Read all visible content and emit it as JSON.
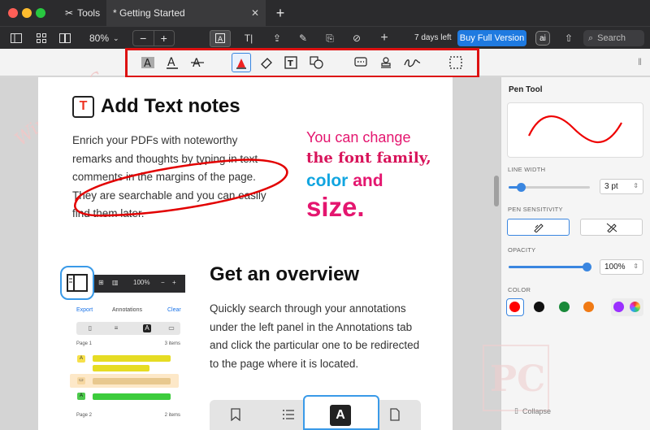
{
  "window": {
    "tabs": [
      {
        "label": "Tools"
      },
      {
        "label": "* Getting Started"
      }
    ]
  },
  "toolbar": {
    "zoom": "80%",
    "trial": "7 days left",
    "buy": "Buy Full Version",
    "ai": "ai",
    "search_placeholder": "Search"
  },
  "document": {
    "watermark": "Winning PC",
    "section1": {
      "title": "Add Text notes",
      "icon_letter": "T",
      "body": "Enrich your PDFs with noteworthy remarks and thoughts by typing in text comments in the margins of the page. They are searchable and you can easily find them later.",
      "note_line1": "You can change",
      "note_line2": "the font family,",
      "note_color": "color",
      "note_and": "and",
      "note_size": "size."
    },
    "section2": {
      "title": "Get an overview",
      "body": "Quickly search through your annotations under the left panel in the Annotations tab and click the particular one to be redirected to the page where it is located."
    },
    "mini": {
      "zoom": "100%",
      "export": "Export",
      "annotations": "Annotations",
      "clear": "Clear",
      "page1": "Page 1",
      "page1_count": "3 items",
      "page2": "Page 2",
      "page2_count": "2 items",
      "tag_a": "A"
    },
    "bottom_tab_a": "A"
  },
  "panel": {
    "title": "Pen Tool",
    "line_width_label": "LINE WIDTH",
    "line_width_value": "3 pt",
    "sensitivity_label": "PEN SENSITIVITY",
    "opacity_label": "OPACITY",
    "opacity_value": "100%",
    "color_label": "COLOR",
    "colors": [
      "#ff0000",
      "#111111",
      "#1a8a3a",
      "#f07a14",
      "#9b30ff"
    ],
    "collapse": "Collapse"
  },
  "brand_logo": "PC"
}
